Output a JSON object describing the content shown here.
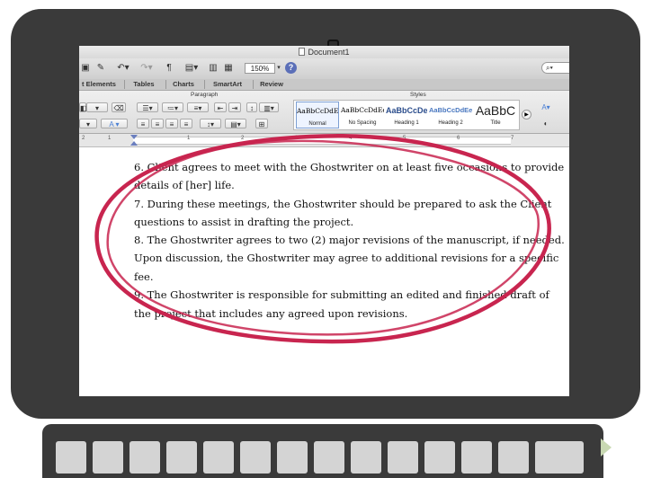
{
  "window": {
    "title": "Document1"
  },
  "toolbar": {
    "zoom": "150%",
    "paragraph_mark": "¶",
    "help": "?"
  },
  "tabs": [
    "t Elements",
    "Tables",
    "Charts",
    "SmartArt",
    "Review"
  ],
  "ribbon": {
    "paragraph_label": "Paragraph",
    "styles_label": "Styles",
    "styles": [
      {
        "sample": "AaBbCcDdEe",
        "name": "Normal"
      },
      {
        "sample": "AaBbCcDdEe",
        "name": "No Spacing"
      },
      {
        "sample": "AaBbCcDe",
        "name": "Heading 1"
      },
      {
        "sample": "AaBbCcDdEe",
        "name": "Heading 2"
      },
      {
        "sample": "AaBbC",
        "name": "Title"
      }
    ]
  },
  "document": {
    "lines": [
      "6. Client agrees to meet with the Ghostwriter on at least five occasions to provide",
      "details of [her] life.",
      "7. During these meetings, the Ghostwriter should be prepared to ask the Client",
      "questions to assist in drafting the project.",
      "8. The Ghostwriter agrees to two (2) major revisions of the manuscript, if needed.",
      "Upon discussion, the Ghostwriter may agree to additional revisions for a specific",
      "fee.",
      "9. The Ghostwriter is responsible for submitting an edited and finished draft of",
      "the project that includes any agreed upon revisions."
    ]
  },
  "colors": {
    "highlight_circle": "#c8254f",
    "laptop_body": "#3a3a3a"
  }
}
